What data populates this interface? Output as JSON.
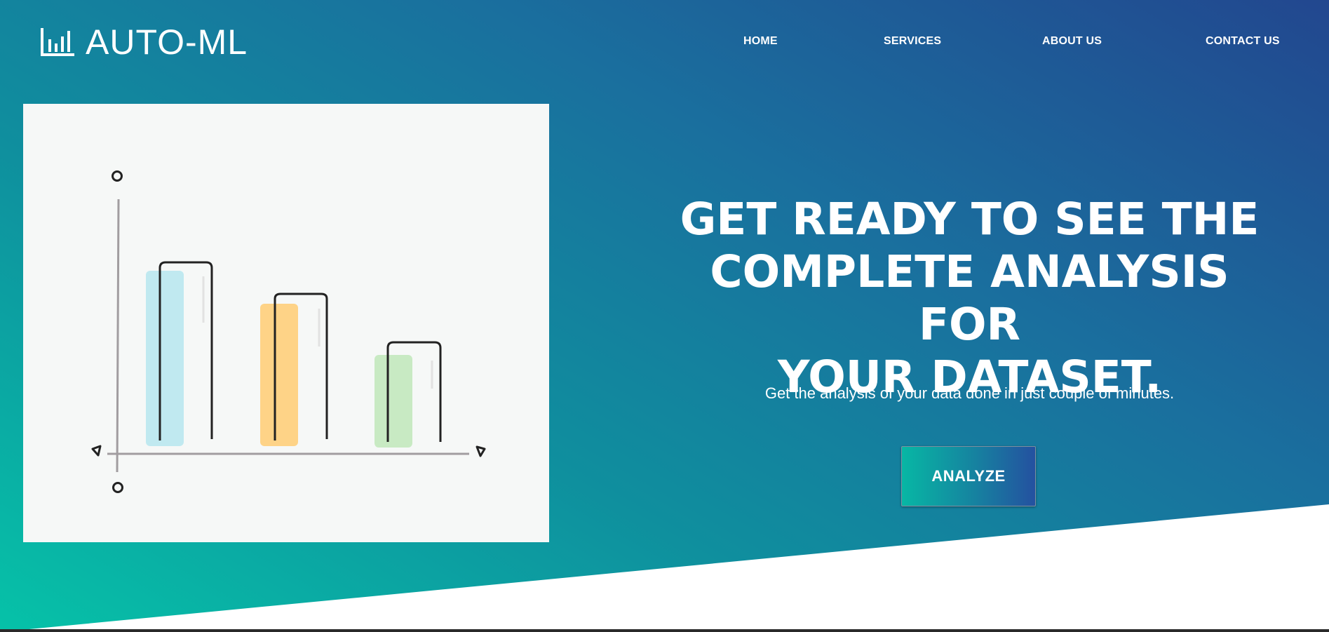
{
  "brand": {
    "name": "AUTO-ML",
    "icon": "bar-chart-icon"
  },
  "nav": {
    "items": [
      {
        "label": "HOME"
      },
      {
        "label": "SERVICES"
      },
      {
        "label": "ABOUT US"
      },
      {
        "label": "CONTACT US"
      }
    ]
  },
  "hero": {
    "headline_lines": [
      "GET READY TO SEE THE",
      "COMPLETE ANALYSIS FOR",
      "YOUR DATASET."
    ],
    "subtext": "Get the analysis of your data done in just couple of minutes.",
    "button_label": "ANALYZE"
  },
  "illustration": {
    "icon": "bar-chart-illustration",
    "bars": [
      {
        "color": "#c0e9f0",
        "level": 0.74
      },
      {
        "color": "#fed387",
        "level": 0.6
      },
      {
        "color": "#c8eac3",
        "level": 0.4
      }
    ]
  },
  "colors": {
    "gradient_start": "#06c2a8",
    "gradient_end": "#22478f",
    "text": "#ffffff"
  }
}
